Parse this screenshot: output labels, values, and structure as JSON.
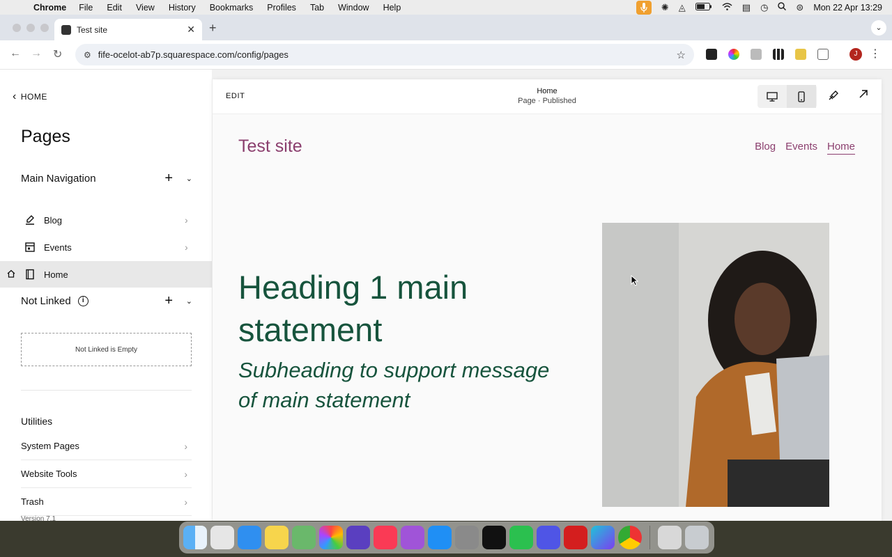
{
  "menubar": {
    "app_name": "Chrome",
    "items": [
      "File",
      "Edit",
      "View",
      "History",
      "Bookmarks",
      "Profiles",
      "Tab",
      "Window",
      "Help"
    ],
    "datetime": "Mon 22 Apr  13:29"
  },
  "browser": {
    "tab_title": "Test site",
    "url": "fife-ocelot-ab7p.squarespace.com/config/pages",
    "profile_initial": "J"
  },
  "sidebar": {
    "back_label": "HOME",
    "title": "Pages",
    "main_nav_label": "Main Navigation",
    "main_nav_items": [
      {
        "label": "Blog",
        "icon": "blog-icon"
      },
      {
        "label": "Events",
        "icon": "calendar-icon"
      },
      {
        "label": "Home",
        "icon": "page-icon"
      }
    ],
    "not_linked_label": "Not Linked",
    "not_linked_empty": "Not Linked is Empty",
    "utilities_label": "Utilities",
    "utilities_items": [
      "System Pages",
      "Website Tools",
      "Trash"
    ],
    "version": "Version 7.1"
  },
  "editor": {
    "edit_label": "EDIT",
    "page_name": "Home",
    "page_status": "Page · Published"
  },
  "site": {
    "title": "Test site",
    "nav": [
      "Blog",
      "Events",
      "Home"
    ],
    "heading": "Heading 1 main statement",
    "subheading": "Subheading to support message of main statement"
  },
  "colors": {
    "site_accent": "#8b3f6e",
    "heading_green": "#17543d",
    "sidebar_active": "#e8e8e8"
  },
  "dock": {
    "apps": [
      "finder",
      "launchpad",
      "safari",
      "notes",
      "maps",
      "photos",
      "imovie",
      "music",
      "podcasts",
      "app-store",
      "system-settings",
      "apple-tv",
      "whatsapp",
      "perplexity",
      "acrobat",
      "canva",
      "chrome",
      "preview",
      "trash"
    ]
  }
}
